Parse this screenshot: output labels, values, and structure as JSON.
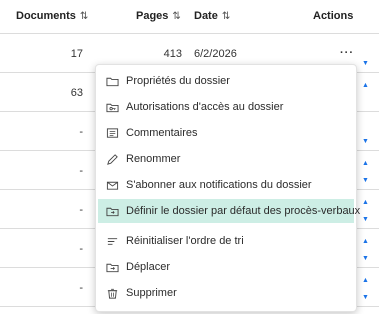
{
  "table": {
    "headers": {
      "documents": "Documents",
      "pages": "Pages",
      "date": "Date",
      "actions": "Actions",
      "sort_glyph": "⇅"
    },
    "rows": [
      {
        "documents": "17",
        "pages": "413",
        "date": "6/2/2026",
        "more": "···"
      },
      {
        "documents": "63",
        "pages": "",
        "date": "",
        "more": ""
      },
      {
        "documents": "-",
        "pages": "",
        "date": "",
        "more": ""
      },
      {
        "documents": "-",
        "pages": "",
        "date": "",
        "more": ""
      },
      {
        "documents": "-",
        "pages": "",
        "date": "",
        "more": ""
      },
      {
        "documents": "-",
        "pages": "",
        "date": "",
        "more": ""
      },
      {
        "documents": "-",
        "pages": "",
        "date": "",
        "more": ""
      }
    ]
  },
  "context_menu": {
    "items": [
      {
        "label": "Propriétés du dossier",
        "icon": "folder-icon"
      },
      {
        "label": "Autorisations d'accès au dossier",
        "icon": "folder-key-icon"
      },
      {
        "label": "Commentaires",
        "icon": "comment-icon"
      },
      {
        "label": "Renommer",
        "icon": "pencil-icon"
      },
      {
        "label": "S'abonner aux notifications du dossier",
        "icon": "mail-subscribe-icon"
      },
      {
        "label": "Définir le dossier par défaut des procès-verbaux",
        "icon": "folder-default-icon",
        "highlighted": true
      },
      {
        "label": "Réinitialiser l'ordre de tri",
        "icon": "sort-reset-icon"
      },
      {
        "label": "Déplacer",
        "icon": "move-icon"
      },
      {
        "label": "Supprimer",
        "icon": "trash-icon"
      }
    ]
  },
  "colors": {
    "highlight": "#cdeee5",
    "accent_arrow": "#1a73e8"
  }
}
